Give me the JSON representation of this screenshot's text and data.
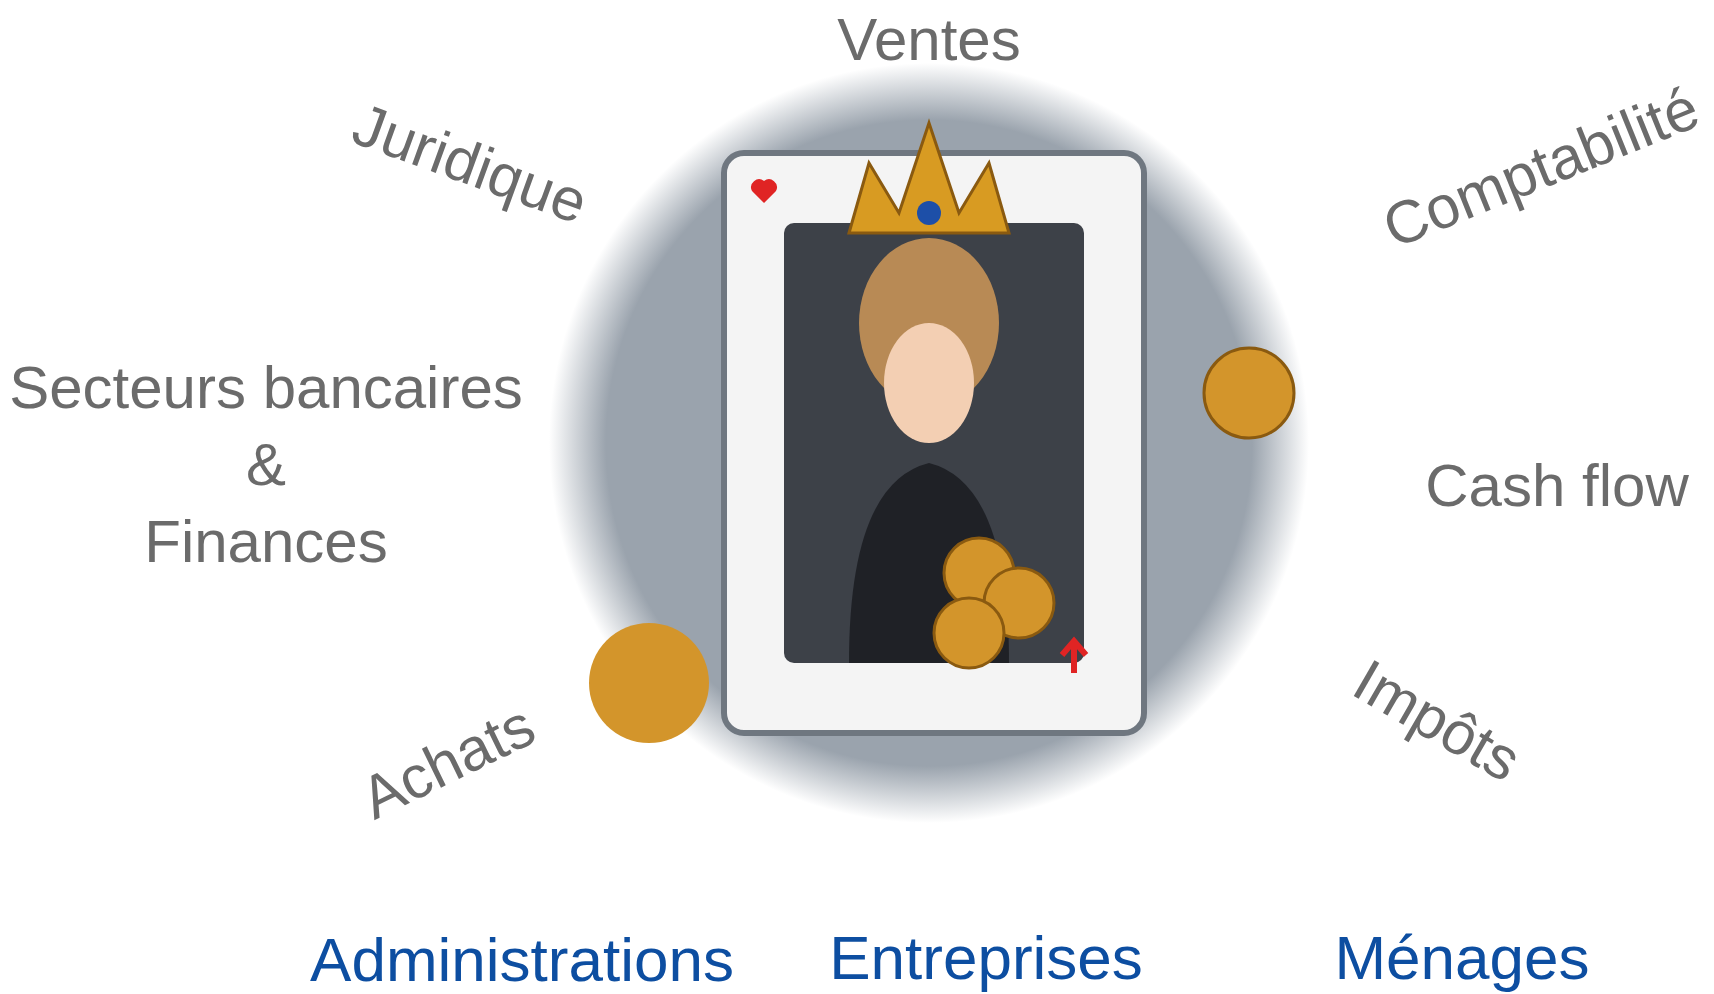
{
  "topics": [
    {
      "kind": "topic",
      "text": "Ventes"
    },
    {
      "kind": "topic",
      "text": "Juridique"
    },
    {
      "kind": "topic",
      "text": "Comptabilité"
    },
    {
      "kind": "stacked",
      "lines": [
        "Secteurs bancaires",
        "&",
        "Finances"
      ]
    },
    {
      "kind": "topic",
      "text": "Cash flow"
    },
    {
      "kind": "topic",
      "text": "Achats"
    },
    {
      "kind": "topic",
      "text": "Impôts"
    }
  ],
  "audiences": [
    {
      "kind": "audience",
      "text": "Administrations"
    },
    {
      "kind": "audience",
      "text": "Entreprises"
    },
    {
      "kind": "audience",
      "text": "Ménages"
    }
  ]
}
